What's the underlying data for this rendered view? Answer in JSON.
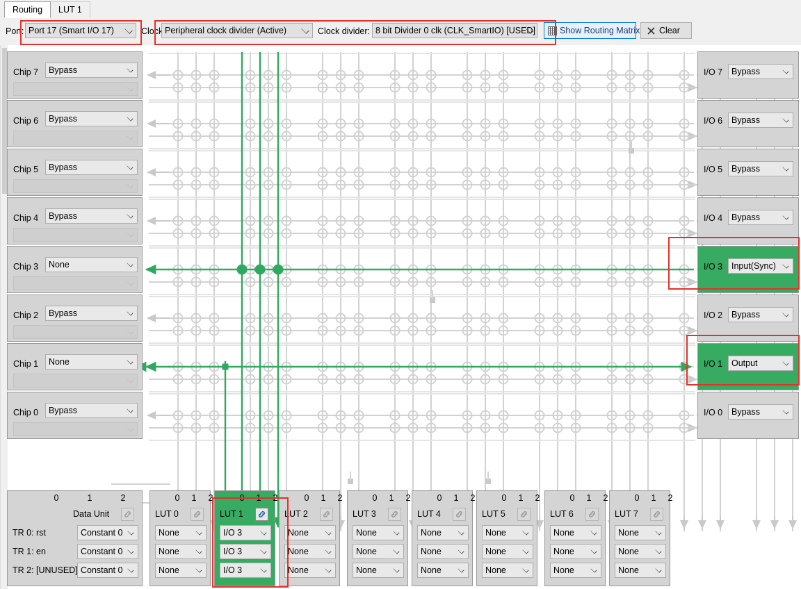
{
  "window": {
    "tabs": [
      {
        "label": "Routing",
        "active": true
      },
      {
        "label": "LUT 1",
        "active": false
      }
    ]
  },
  "toolbar": {
    "port_label": "Port:",
    "port_value": "Port 17 (Smart I/O 17)",
    "clock_label": "Clock:",
    "clock_value": "Peripheral clock divider (Active)",
    "divider_label": "Clock divider:",
    "divider_value": "8 bit Divider 0 clk (CLK_SmartIO) [USED]",
    "show_matrix_label": "Show Routing Matrix",
    "show_matrix_icon": "grid-icon",
    "clear_label": "Clear",
    "clear_icon": "close-x-icon"
  },
  "chips": [
    {
      "name": "Chip 7",
      "value": "Bypass",
      "sub": "",
      "active": false
    },
    {
      "name": "Chip 6",
      "value": "Bypass",
      "sub": "",
      "active": false
    },
    {
      "name": "Chip 5",
      "value": "Bypass",
      "sub": "",
      "active": false
    },
    {
      "name": "Chip 4",
      "value": "Bypass",
      "sub": "",
      "active": false
    },
    {
      "name": "Chip 3",
      "value": "None",
      "sub": "",
      "active": false
    },
    {
      "name": "Chip 2",
      "value": "Bypass",
      "sub": "",
      "active": false
    },
    {
      "name": "Chip 1",
      "value": "None",
      "sub": "",
      "active": false
    },
    {
      "name": "Chip 0",
      "value": "Bypass",
      "sub": "",
      "active": false
    }
  ],
  "ios": [
    {
      "name": "I/O 7",
      "value": "Bypass",
      "active": false,
      "annotated": false
    },
    {
      "name": "I/O 6",
      "value": "Bypass",
      "active": false,
      "annotated": false
    },
    {
      "name": "I/O 5",
      "value": "Bypass",
      "active": false,
      "annotated": false
    },
    {
      "name": "I/O 4",
      "value": "Bypass",
      "active": false,
      "annotated": false
    },
    {
      "name": "I/O 3",
      "value": "Input(Sync)",
      "active": true,
      "annotated": true
    },
    {
      "name": "I/O 2",
      "value": "Bypass",
      "active": false,
      "annotated": false
    },
    {
      "name": "I/O 1",
      "value": "Output",
      "active": true,
      "annotated": true
    },
    {
      "name": "I/O 0",
      "value": "Bypass",
      "active": false,
      "annotated": false
    }
  ],
  "data_unit": {
    "title": "Data Unit",
    "columns": [
      "0",
      "1",
      "2"
    ],
    "link_icon": "link-icon",
    "rows": [
      {
        "label": "TR 0: rst",
        "value": "Constant 0"
      },
      {
        "label": "TR 1: en",
        "value": "Constant 0"
      },
      {
        "label": "TR 2: [UNUSED]",
        "value": "Constant 0"
      }
    ]
  },
  "luts": [
    {
      "title": "LUT 0",
      "columns": [
        "0",
        "1",
        "2"
      ],
      "inputs": [
        "None",
        "None",
        "None"
      ],
      "active": false,
      "annotated": false,
      "link_icon": "link-icon"
    },
    {
      "title": "LUT 1",
      "columns": [
        "0",
        "1",
        "2"
      ],
      "inputs": [
        "I/O 3",
        "I/O 3",
        "I/O 3"
      ],
      "active": true,
      "annotated": true,
      "link_icon": "link-icon"
    },
    {
      "title": "LUT 2",
      "columns": [
        "0",
        "1",
        "2"
      ],
      "inputs": [
        "None",
        "None",
        "None"
      ],
      "active": false,
      "annotated": false,
      "link_icon": "link-icon"
    },
    {
      "title": "LUT 3",
      "columns": [
        "0",
        "1",
        "2"
      ],
      "inputs": [
        "None",
        "None",
        "None"
      ],
      "active": false,
      "annotated": false,
      "link_icon": "link-icon"
    },
    {
      "title": "LUT 4",
      "columns": [
        "0",
        "1",
        "2"
      ],
      "inputs": [
        "None",
        "None",
        "None"
      ],
      "active": false,
      "annotated": false,
      "link_icon": "link-icon"
    },
    {
      "title": "LUT 5",
      "columns": [
        "0",
        "1",
        "2"
      ],
      "inputs": [
        "None",
        "None",
        "None"
      ],
      "active": false,
      "annotated": false,
      "link_icon": "link-icon"
    },
    {
      "title": "LUT 6",
      "columns": [
        "0",
        "1",
        "2"
      ],
      "inputs": [
        "None",
        "None",
        "None"
      ],
      "active": false,
      "annotated": false,
      "link_icon": "link-icon"
    },
    {
      "title": "LUT 7",
      "columns": [
        "0",
        "1",
        "2"
      ],
      "inputs": [
        "None",
        "None",
        "None"
      ],
      "active": false,
      "annotated": false,
      "link_icon": "link-icon"
    }
  ],
  "colors": {
    "accent_green": "#37ab62",
    "route_green": "#2fa95f",
    "annotation_red": "#e8302a",
    "grid_gray": "#cfcfcf",
    "panel_gray": "#d4d4d4",
    "link_blue": "#1a3f7a"
  }
}
